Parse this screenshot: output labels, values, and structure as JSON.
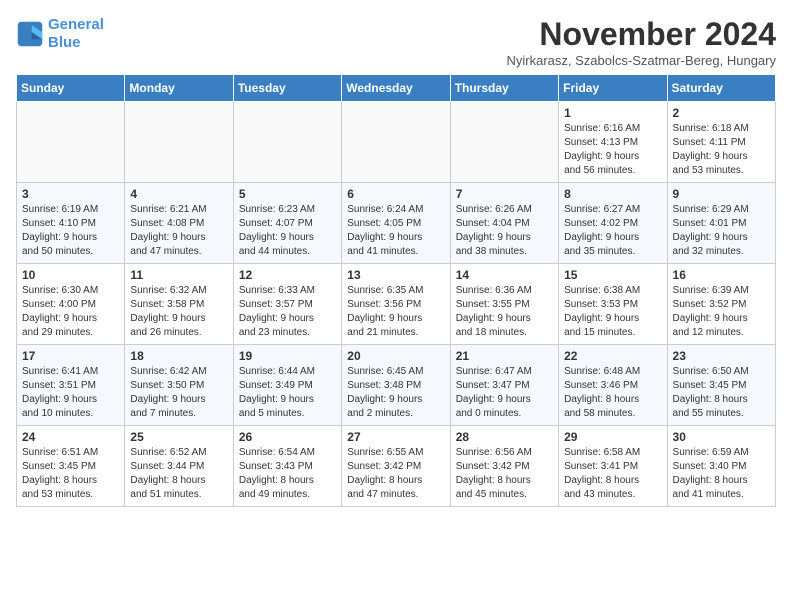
{
  "logo": {
    "line1": "General",
    "line2": "Blue"
  },
  "title": "November 2024",
  "location": "Nyirkarasz, Szabolcs-Szatmar-Bereg, Hungary",
  "days_header": [
    "Sunday",
    "Monday",
    "Tuesday",
    "Wednesday",
    "Thursday",
    "Friday",
    "Saturday"
  ],
  "weeks": [
    [
      {
        "day": "",
        "info": ""
      },
      {
        "day": "",
        "info": ""
      },
      {
        "day": "",
        "info": ""
      },
      {
        "day": "",
        "info": ""
      },
      {
        "day": "",
        "info": ""
      },
      {
        "day": "1",
        "info": "Sunrise: 6:16 AM\nSunset: 4:13 PM\nDaylight: 9 hours\nand 56 minutes."
      },
      {
        "day": "2",
        "info": "Sunrise: 6:18 AM\nSunset: 4:11 PM\nDaylight: 9 hours\nand 53 minutes."
      }
    ],
    [
      {
        "day": "3",
        "info": "Sunrise: 6:19 AM\nSunset: 4:10 PM\nDaylight: 9 hours\nand 50 minutes."
      },
      {
        "day": "4",
        "info": "Sunrise: 6:21 AM\nSunset: 4:08 PM\nDaylight: 9 hours\nand 47 minutes."
      },
      {
        "day": "5",
        "info": "Sunrise: 6:23 AM\nSunset: 4:07 PM\nDaylight: 9 hours\nand 44 minutes."
      },
      {
        "day": "6",
        "info": "Sunrise: 6:24 AM\nSunset: 4:05 PM\nDaylight: 9 hours\nand 41 minutes."
      },
      {
        "day": "7",
        "info": "Sunrise: 6:26 AM\nSunset: 4:04 PM\nDaylight: 9 hours\nand 38 minutes."
      },
      {
        "day": "8",
        "info": "Sunrise: 6:27 AM\nSunset: 4:02 PM\nDaylight: 9 hours\nand 35 minutes."
      },
      {
        "day": "9",
        "info": "Sunrise: 6:29 AM\nSunset: 4:01 PM\nDaylight: 9 hours\nand 32 minutes."
      }
    ],
    [
      {
        "day": "10",
        "info": "Sunrise: 6:30 AM\nSunset: 4:00 PM\nDaylight: 9 hours\nand 29 minutes."
      },
      {
        "day": "11",
        "info": "Sunrise: 6:32 AM\nSunset: 3:58 PM\nDaylight: 9 hours\nand 26 minutes."
      },
      {
        "day": "12",
        "info": "Sunrise: 6:33 AM\nSunset: 3:57 PM\nDaylight: 9 hours\nand 23 minutes."
      },
      {
        "day": "13",
        "info": "Sunrise: 6:35 AM\nSunset: 3:56 PM\nDaylight: 9 hours\nand 21 minutes."
      },
      {
        "day": "14",
        "info": "Sunrise: 6:36 AM\nSunset: 3:55 PM\nDaylight: 9 hours\nand 18 minutes."
      },
      {
        "day": "15",
        "info": "Sunrise: 6:38 AM\nSunset: 3:53 PM\nDaylight: 9 hours\nand 15 minutes."
      },
      {
        "day": "16",
        "info": "Sunrise: 6:39 AM\nSunset: 3:52 PM\nDaylight: 9 hours\nand 12 minutes."
      }
    ],
    [
      {
        "day": "17",
        "info": "Sunrise: 6:41 AM\nSunset: 3:51 PM\nDaylight: 9 hours\nand 10 minutes."
      },
      {
        "day": "18",
        "info": "Sunrise: 6:42 AM\nSunset: 3:50 PM\nDaylight: 9 hours\nand 7 minutes."
      },
      {
        "day": "19",
        "info": "Sunrise: 6:44 AM\nSunset: 3:49 PM\nDaylight: 9 hours\nand 5 minutes."
      },
      {
        "day": "20",
        "info": "Sunrise: 6:45 AM\nSunset: 3:48 PM\nDaylight: 9 hours\nand 2 minutes."
      },
      {
        "day": "21",
        "info": "Sunrise: 6:47 AM\nSunset: 3:47 PM\nDaylight: 9 hours\nand 0 minutes."
      },
      {
        "day": "22",
        "info": "Sunrise: 6:48 AM\nSunset: 3:46 PM\nDaylight: 8 hours\nand 58 minutes."
      },
      {
        "day": "23",
        "info": "Sunrise: 6:50 AM\nSunset: 3:45 PM\nDaylight: 8 hours\nand 55 minutes."
      }
    ],
    [
      {
        "day": "24",
        "info": "Sunrise: 6:51 AM\nSunset: 3:45 PM\nDaylight: 8 hours\nand 53 minutes."
      },
      {
        "day": "25",
        "info": "Sunrise: 6:52 AM\nSunset: 3:44 PM\nDaylight: 8 hours\nand 51 minutes."
      },
      {
        "day": "26",
        "info": "Sunrise: 6:54 AM\nSunset: 3:43 PM\nDaylight: 8 hours\nand 49 minutes."
      },
      {
        "day": "27",
        "info": "Sunrise: 6:55 AM\nSunset: 3:42 PM\nDaylight: 8 hours\nand 47 minutes."
      },
      {
        "day": "28",
        "info": "Sunrise: 6:56 AM\nSunset: 3:42 PM\nDaylight: 8 hours\nand 45 minutes."
      },
      {
        "day": "29",
        "info": "Sunrise: 6:58 AM\nSunset: 3:41 PM\nDaylight: 8 hours\nand 43 minutes."
      },
      {
        "day": "30",
        "info": "Sunrise: 6:59 AM\nSunset: 3:40 PM\nDaylight: 8 hours\nand 41 minutes."
      }
    ]
  ]
}
